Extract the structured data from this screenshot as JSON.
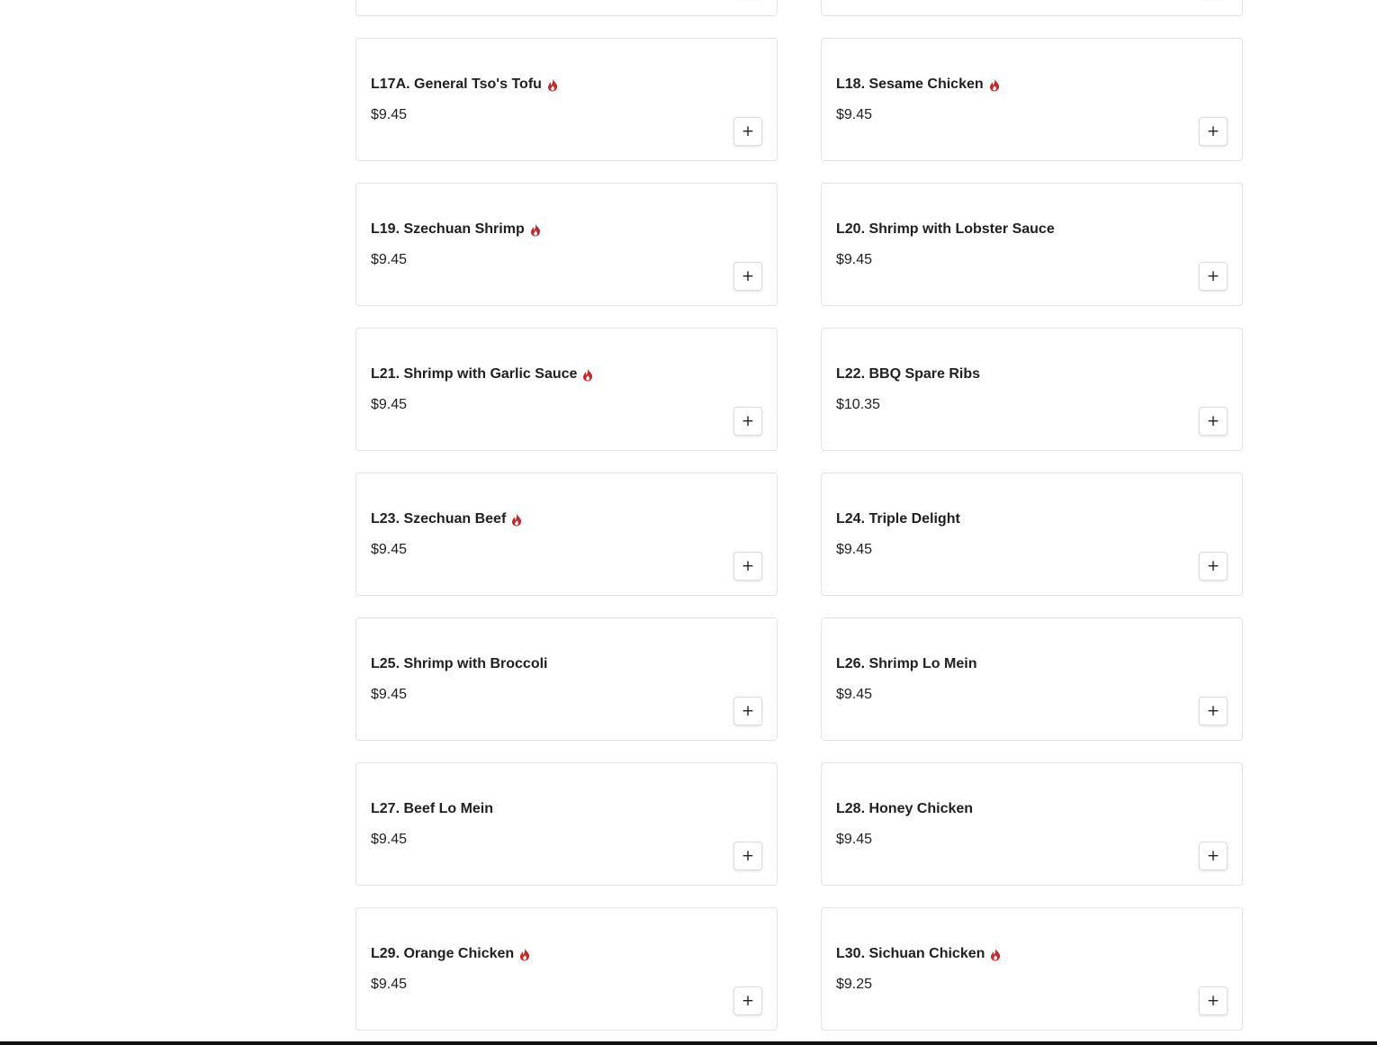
{
  "colors": {
    "spicy": "#c62828",
    "border": "#e3e3e3",
    "bottom_bar": "#111111"
  },
  "add_icon": "+",
  "menu": {
    "items": [
      {
        "name": "L17A. General Tso's Tofu",
        "price": "$9.45",
        "spicy": true
      },
      {
        "name": "L18. Sesame Chicken",
        "price": "$9.45",
        "spicy": true
      },
      {
        "name": "L19. Szechuan Shrimp",
        "price": "$9.45",
        "spicy": true
      },
      {
        "name": "L20. Shrimp with Lobster Sauce",
        "price": "$9.45",
        "spicy": false
      },
      {
        "name": "L21. Shrimp with Garlic Sauce",
        "price": "$9.45",
        "spicy": true
      },
      {
        "name": "L22. BBQ Spare Ribs",
        "price": "$10.35",
        "spicy": false
      },
      {
        "name": "L23. Szechuan Beef",
        "price": "$9.45",
        "spicy": true
      },
      {
        "name": "L24. Triple Delight",
        "price": "$9.45",
        "spicy": false
      },
      {
        "name": "L25. Shrimp with Broccoli",
        "price": "$9.45",
        "spicy": false
      },
      {
        "name": "L26. Shrimp Lo Mein",
        "price": "$9.45",
        "spicy": false
      },
      {
        "name": "L27. Beef Lo Mein",
        "price": "$9.45",
        "spicy": false
      },
      {
        "name": "L28. Honey Chicken",
        "price": "$9.45",
        "spicy": false
      },
      {
        "name": "L29. Orange Chicken",
        "price": "$9.45",
        "spicy": true
      },
      {
        "name": "L30. Sichuan Chicken",
        "price": "$9.25",
        "spicy": true
      }
    ]
  }
}
